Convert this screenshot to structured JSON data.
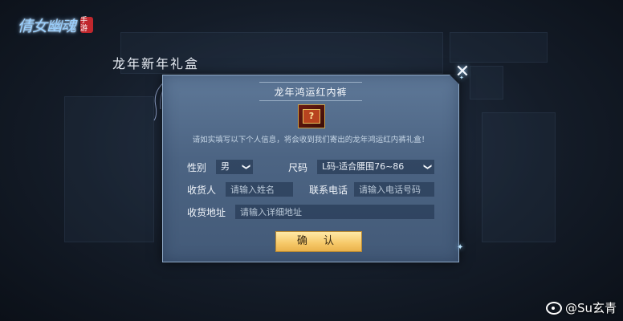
{
  "logo": {
    "text": "倩女幽魂",
    "seal": "手游"
  },
  "gift_title": "龙年新年礼盒",
  "dialog": {
    "title": "龙年鸿运红内裤",
    "gift_icon_char": "?",
    "info": "请如实填写以下个人信息，将会收到我们寄出的龙年鸿运红内裤礼盒！",
    "gender": {
      "label": "性别",
      "value": "男"
    },
    "size": {
      "label": "尺码",
      "value": "L码-适合腰围76~86"
    },
    "recipient": {
      "label": "收货人",
      "placeholder": "请输入姓名"
    },
    "phone": {
      "label": "联系电话",
      "placeholder": "请输入电话号码"
    },
    "address": {
      "label": "收货地址",
      "placeholder": "请输入详细地址"
    },
    "confirm": "确 认",
    "close_glyph": "✕",
    "chevron_glyph": "❯"
  },
  "watermark": "@Su玄青",
  "colors": {
    "dialog": "#4f6888",
    "confirm": "#f6c868",
    "background": "#141c28"
  }
}
